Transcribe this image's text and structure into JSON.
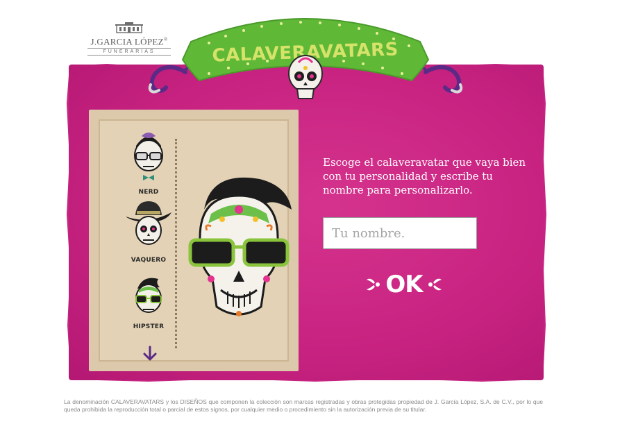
{
  "logo": {
    "name": "J.GARCIA LÓPEZ",
    "registered": "®",
    "subtitle": "FUNERARIAS"
  },
  "banner": {
    "title": "CALAVERAVATARS"
  },
  "avatar_picker": {
    "options": [
      {
        "label": "NERD"
      },
      {
        "label": "VAQUERO"
      },
      {
        "label": "HIPSTER"
      }
    ],
    "scroll_icon": "arrow-down-icon"
  },
  "form": {
    "instructions": "Escoge el calaveravatar que vaya bien con tu personalidad y escribe tu nombre para personalizarlo.",
    "name_placeholder": "Tu nombre.",
    "name_value": "",
    "submit_label": "OK"
  },
  "legal": {
    "text": "La denominación CALAVERAVATARS y los DISEÑOS que componen la colección son marcas registradas y obras protegidas propiedad de J. García López, S.A. de C.V., por lo que queda prohibida la reproducción total o parcial de estos signos, por cualquier medio o procedimiento sin la autorización previa de su titular."
  },
  "colors": {
    "paper_pink": "#c92382",
    "banner_green": "#5fb836",
    "banner_text": "#d6e36a",
    "accent_purple": "#5b2a86",
    "stamp_beige": "#dcc9ab"
  }
}
